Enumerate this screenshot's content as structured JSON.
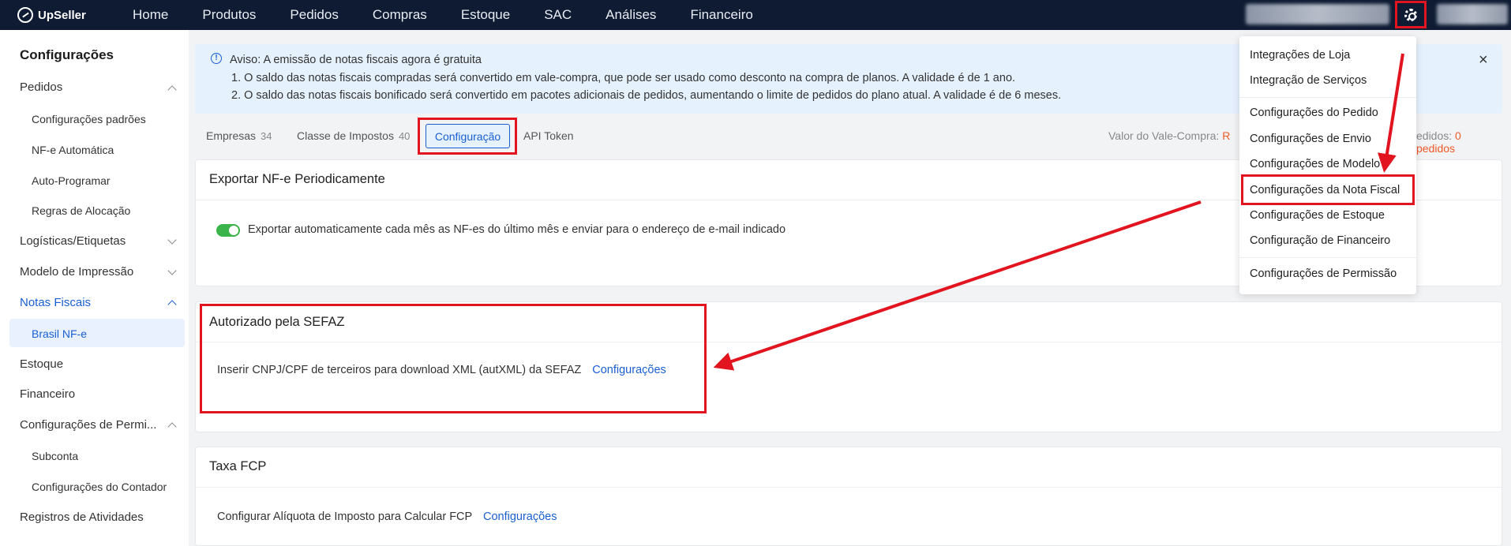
{
  "app": {
    "logo": "UpSeller"
  },
  "nav": [
    "Home",
    "Produtos",
    "Pedidos",
    "Compras",
    "Estoque",
    "SAC",
    "Análises",
    "Financeiro"
  ],
  "sidebar": {
    "title": "Configurações",
    "pedidos": "Pedidos",
    "config_padroes": "Configurações padrões",
    "nfe_auto": "NF-e Automática",
    "auto_prog": "Auto-Programar",
    "regras": "Regras de Alocação",
    "logisticas": "Logísticas/Etiquetas",
    "modelo": "Modelo de Impressão",
    "notas": "Notas Fiscais",
    "brasil": "Brasil NF-e",
    "estoque": "Estoque",
    "financeiro": "Financeiro",
    "permi": "Configurações de Permi...",
    "subconta": "Subconta",
    "contador": "Configurações do Contador",
    "registros": "Registros de Atividades"
  },
  "notice": {
    "title": "Aviso: A emissão de notas fiscais agora é gratuita",
    "line1": "1. O saldo das notas fiscais compradas será convertido em vale-compra, que pode ser usado como desconto na compra de planos. A validade é de 1 ano.",
    "line2": "2. O saldo das notas fiscais bonificado será convertido em pacotes adicionais de pedidos, aumentando o limite de pedidos do plano atual. A validade é de 6 meses.",
    "close": "×"
  },
  "tabs": {
    "empresas": "Empresas",
    "empresas_count": "34",
    "classe": "Classe de Impostos",
    "classe_count": "40",
    "configuracao": "Configuração",
    "api": "API Token",
    "valor_label": "Valor do Vale-Compra:",
    "valor_value": "R",
    "pedidos_label": "edidos:",
    "pedidos_value": "0 pedidos"
  },
  "cards": {
    "exportar": {
      "title": "Exportar NF-e Periodicamente",
      "text": "Exportar automaticamente cada mês as NF-es do último mês e enviar para o endereço de e-mail indicado"
    },
    "sefaz": {
      "title": "Autorizado pela SEFAZ",
      "text": "Inserir CNPJ/CPF de terceiros para download XML (autXML) da SEFAZ",
      "link": "Configurações"
    },
    "fcp": {
      "title": "Taxa FCP",
      "text": "Configurar Alíquota de Imposto para Calcular FCP",
      "link": "Configurações"
    }
  },
  "dropdown": [
    "Integrações de Loja",
    "Integração de Serviços",
    "Configurações do Pedido",
    "Configurações de Envio",
    "Configurações de Modelo",
    "Configurações da Nota Fiscal",
    "Configurações de Estoque",
    "Configuração de Financeiro",
    "Configurações de Permissão"
  ],
  "icons": {
    "gear": "gear-icon",
    "info": "info-icon",
    "close": "close-icon",
    "logo": "upseller-logo-icon"
  },
  "colors": {
    "nav_bg": "#0e1b33",
    "accent": "#1a5fd1",
    "highlight": "#e1141f",
    "toggle_on": "#3bb54a",
    "notice_bg": "#e6f1fe",
    "warning_text": "#f05a28"
  }
}
